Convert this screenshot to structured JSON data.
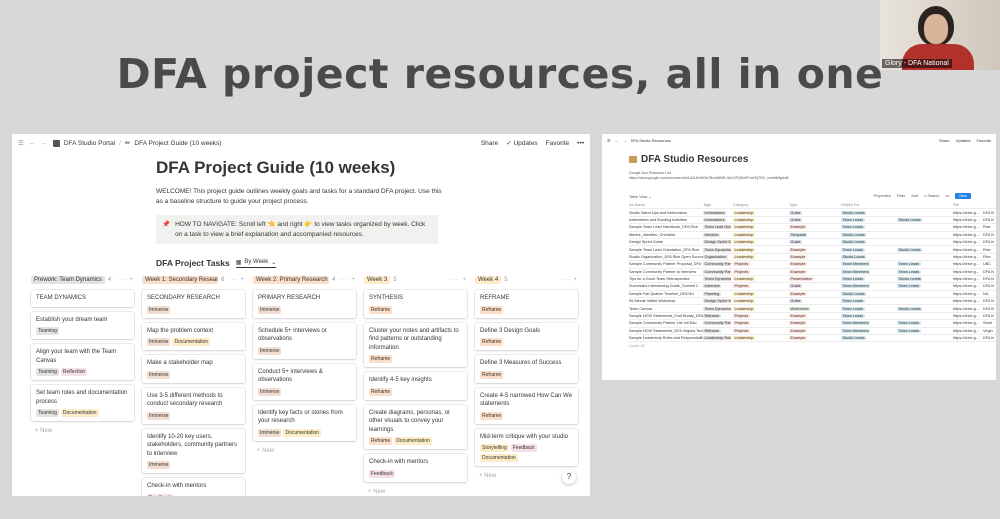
{
  "slide": {
    "title": "DFA project resources, all in one"
  },
  "webcam": {
    "label": "Glory - DFA National"
  },
  "left_window": {
    "topbar": {
      "workspace": "DFA Studio Portal",
      "page": "DFA Project Guide (10 weeks)",
      "share": "Share",
      "updates": "Updates",
      "favorite": "Favorite",
      "more": "•••"
    },
    "title": "DFA Project Guide (10 weeks)",
    "intro": "WELCOME! This project guide outlines weekly goals and tasks for a standard DFA project. Use this as a baseline structure to guide your project process.",
    "callout": "HOW TO NAVIGATE: Scroll left 👈 and right 👉 to view tasks organized by week. Click on a task to view a brief explanation and accompanied resources.",
    "board_title": "DFA Project Tasks",
    "view_label": "By Week",
    "new_label": "+ New",
    "columns": [
      {
        "name": "Prework: Team Dynamics",
        "count": "4",
        "color": "#e3e2e0",
        "cards": [
          {
            "title": "TEAM DYNAMICS",
            "tags": []
          },
          {
            "title": "Establish your dream team",
            "tags": [
              "Teaming"
            ]
          },
          {
            "title": "Align your team with the Team Canvas",
            "tags": [
              "Teaming",
              "Reflection"
            ]
          },
          {
            "title": "Set team roles and documentation process",
            "tags": [
              "Teaming",
              "Documentation"
            ]
          }
        ]
      },
      {
        "name": "Week 1: Secondary Research",
        "count": "6",
        "color": "#fadec9",
        "cards": [
          {
            "title": "SECONDARY RESEARCH",
            "tags": [
              "Immerse"
            ]
          },
          {
            "title": "Map the problem context",
            "tags": [
              "Immerse",
              "Documentation"
            ]
          },
          {
            "title": "Make a stakeholder map",
            "tags": [
              "Immerse"
            ]
          },
          {
            "title": "Use 3-5 different methods to conduct secondary research",
            "tags": [
              "Immerse"
            ]
          },
          {
            "title": "Identify 10-20 key users, stakeholders, community partners to interview",
            "tags": [
              "Immerse"
            ]
          },
          {
            "title": "Check-in with mentors",
            "tags": [
              "Feedback"
            ]
          }
        ]
      },
      {
        "name": "Week 2: Primary Research",
        "count": "4",
        "color": "#fadec9",
        "cards": [
          {
            "title": "PRIMARY RESEARCH",
            "tags": [
              "Immerse"
            ]
          },
          {
            "title": "Schedule 5+ interviews or observations",
            "tags": [
              "Immerse"
            ]
          },
          {
            "title": "Conduct 5+ interviews & observations",
            "tags": [
              "Immerse"
            ]
          },
          {
            "title": "Identify key facts or stories from your research",
            "tags": [
              "Immerse",
              "Documentation"
            ]
          }
        ]
      },
      {
        "name": "Week 3",
        "count": "5",
        "color": "#fdecc8",
        "cards": [
          {
            "title": "SYNTHESIS",
            "tags": [
              "Reframe"
            ]
          },
          {
            "title": "Cluster your notes and artifacts to find patterns or outstanding information",
            "tags": [
              "Reframe"
            ]
          },
          {
            "title": "Identify 4-5 key insights",
            "tags": [
              "Reframe"
            ]
          },
          {
            "title": "Create diagrams, personas, or other visuals to convey your learnings",
            "tags": [
              "Reframe",
              "Documentation"
            ]
          },
          {
            "title": "Check-in with mentors",
            "tags": [
              "Feedback"
            ]
          }
        ]
      },
      {
        "name": "Week 4",
        "count": "5",
        "color": "#fdecc8",
        "cards": [
          {
            "title": "REFRAME",
            "tags": [
              "Reframe"
            ]
          },
          {
            "title": "Define 3 Design Goals",
            "tags": [
              "Reframe"
            ]
          },
          {
            "title": "Define 3 Measures of Success",
            "tags": [
              "Reframe"
            ]
          },
          {
            "title": "Create 4-5 narrowed How Can We statements",
            "tags": [
              "Reframe"
            ]
          },
          {
            "title": "Mid-term critique with your studio",
            "tags": [
              "Storytelling",
              "Feedback",
              "Documentation"
            ]
          }
        ]
      }
    ],
    "help": "?"
  },
  "right_window": {
    "topbar": {
      "crumb": "DFA Studio Resources",
      "share": "Share",
      "updates": "Updates",
      "favorite": "Favorite"
    },
    "title": "DFA Studio Resources",
    "sub1": "Google Doc Resource List",
    "sub2": "https://docs.google.com/document/d/1cDL6vNKfs7Bo4a5WK-5s1GFQDcRYmHQ7BV_mwhtMfg/edit",
    "toolbar": {
      "view": "Table View",
      "properties": "Properties",
      "filter": "Filter",
      "sort": "Sort",
      "search": "Search",
      "new": "New"
    },
    "headers": [
      "Aa Name",
      "Tags",
      "Category",
      "Type",
      "Helpful For",
      "",
      "File",
      ""
    ],
    "rows": [
      [
        "Studio Warm Ups and Icebreakers",
        "Icebreakers",
        "Leadership",
        "Guide",
        "Studio Leads",
        "",
        "https://drive.g...",
        "DFA N"
      ],
      [
        "Icebreakers and Bonding Activities",
        "Icebreakers",
        "Leadership",
        "Guide",
        "Team Leads",
        "Studio Leads",
        "https://drive.g...",
        "DFA N"
      ],
      [
        "Sample Team Lead Handbook_DFA Rice",
        "Team Lead Guide",
        "Leadership",
        "Example",
        "Team Leads",
        "",
        "https://drive.g...",
        "Rice"
      ],
      [
        "Mentor_Identifier_Checklist",
        "Mentors",
        "Leadership",
        "Template",
        "Studio Leads",
        "",
        "https://drive.g...",
        "DFA N"
      ],
      [
        "Design Sprint Guide",
        "Design Sprint Workshop",
        "Leadership",
        "Guide",
        "Studio Leads",
        "",
        "https://drive.g...",
        "DFA N"
      ],
      [
        "Sample Team Lead Orientation_DFA Rice",
        "Team Dynamics",
        "Leadership",
        "Example",
        "Team Leads",
        "Studio Leads",
        "https://drive.g...",
        "Rice"
      ],
      [
        "Studio Organization_DFA Rice Open Source",
        "Organization",
        "Leadership",
        "Example",
        "Studio Leads",
        "",
        "https://drive.g...",
        "Rice"
      ],
      [
        "Sample Community Partner Proposal_DFA",
        "Community Partners",
        "Projects",
        "Example",
        "Team Members",
        "Team Leads",
        "https://drive.g...",
        "UBC"
      ],
      [
        "Sample Community Partner to Interview",
        "Community Partners",
        "Projects",
        "Example",
        "Team Members",
        "Team Leads",
        "https://drive.g...",
        "DFA N"
      ],
      [
        "Tips for a Good Team Retrospective",
        "Team Dynamics",
        "Leadership",
        "Presentation",
        "Team Leads",
        "Studio Leads",
        "https://drive.g...",
        "DFA N"
      ],
      [
        "Successful Interviewing Guide_Summit 2",
        "Interview",
        "Projects",
        "Guide",
        "Team Members",
        "Team Leads",
        "https://drive.g...",
        "DFA N"
      ],
      [
        "Sample Fall Quarter Timeline_DFA NU",
        "Planning",
        "Leadership",
        "Example",
        "Studio Leads",
        "",
        "https://drive.g...",
        "NU"
      ],
      [
        "90-Minute Wallet Workshop",
        "Design Sprint Workshop",
        "Leadership",
        "Guide",
        "Team Leads",
        "",
        "https://drive.g...",
        "DFA N"
      ],
      [
        "Team Canvas",
        "Team Dynamics",
        "Leadership",
        "Worksheet",
        "Team Leads",
        "Studio Leads",
        "https://drive.g...",
        "DFA N"
      ],
      [
        "Sample HCW Statements_Fruit Buddy_DFA",
        "Reframe",
        "Projects",
        "Example",
        "Team Leads",
        "",
        "https://drive.g...",
        "DFA N"
      ],
      [
        "Sample Community Partner List Intl Edu",
        "Community Partners",
        "Projects",
        "Example",
        "Team Members",
        "Team Leads",
        "https://drive.g...",
        "Stanf"
      ],
      [
        "Sample HCW Statements_DFA Virginia Tech",
        "Reframe",
        "Projects",
        "Example",
        "Team Members",
        "Team Leads",
        "https://drive.g...",
        "Virgin"
      ],
      [
        "Sample Leadership Roles and Responsibilities",
        "Leadership Roles",
        "Leadership",
        "Example",
        "Studio Leads",
        "",
        "https://drive.g...",
        "DFA N"
      ]
    ],
    "count": "Count: 40"
  }
}
